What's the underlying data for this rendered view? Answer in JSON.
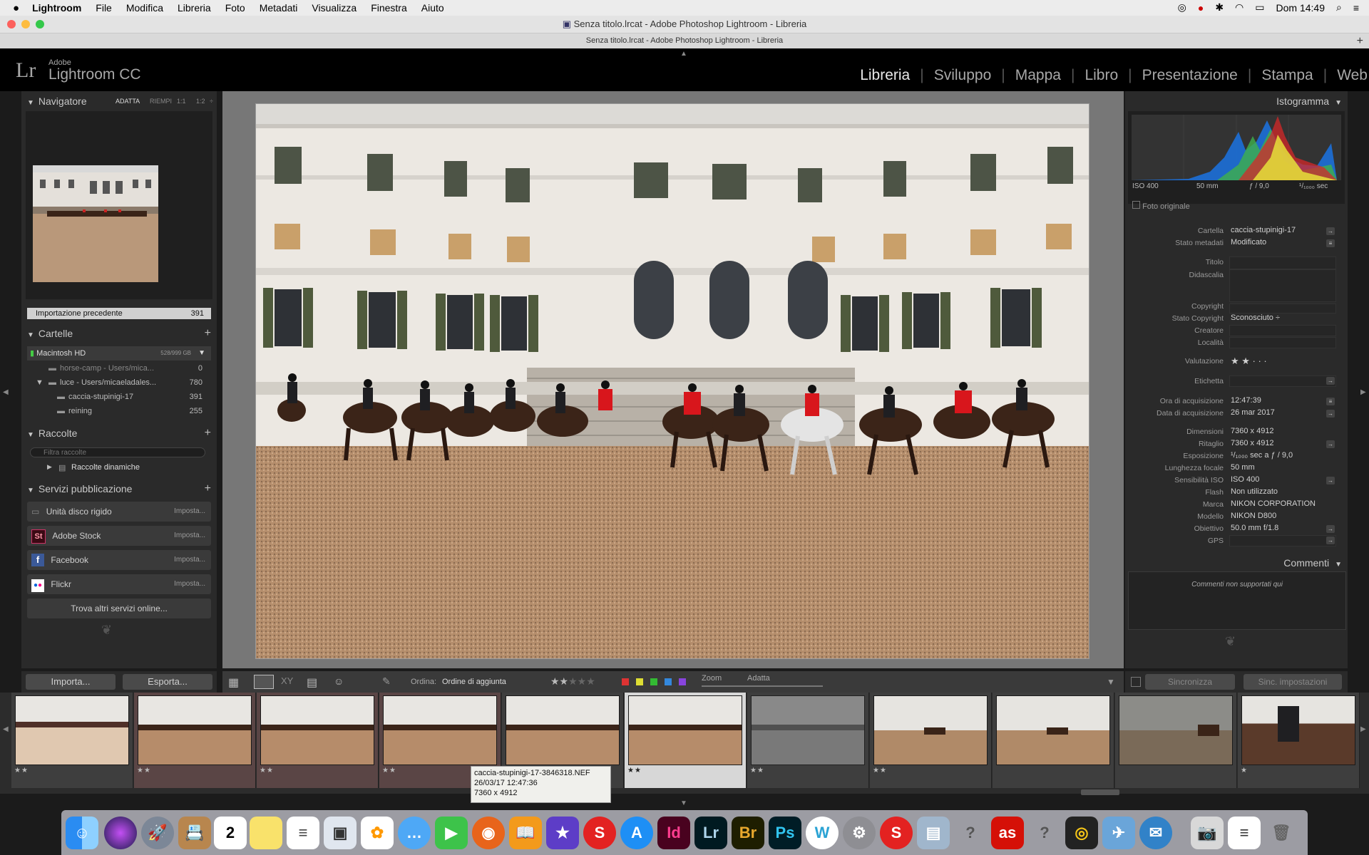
{
  "menubar": {
    "app_name": "Lightroom",
    "items": [
      "File",
      "Modifica",
      "Libreria",
      "Foto",
      "Metadati",
      "Visualizza",
      "Finestra",
      "Aiuto"
    ],
    "clock": "Dom 14:49"
  },
  "window": {
    "title": "Senza titolo.lrcat - Adobe Photoshop Lightroom - Libreria",
    "subtitle": "Senza titolo.lrcat - Adobe Photoshop Lightroom - Libreria"
  },
  "brand": {
    "logo": "Lr",
    "line1": "Adobe",
    "line2": "Lightroom CC"
  },
  "modules": [
    "Libreria",
    "Sviluppo",
    "Mappa",
    "Libro",
    "Presentazione",
    "Stampa",
    "Web"
  ],
  "navigator": {
    "title": "Navigatore",
    "zoom_options": [
      "ADATTA",
      "RIEMPI",
      "1:1",
      "1:2"
    ]
  },
  "catalog": {
    "label": "Importazione precedente",
    "count": "391"
  },
  "folders": {
    "title": "Cartelle",
    "volume": {
      "name": "Macintosh HD",
      "size": "528/999 GB"
    },
    "items": [
      {
        "name": "horse-camp - Users/mica...",
        "count": "0"
      },
      {
        "name": "luce - Users/micaeladales...",
        "count": "780"
      },
      {
        "name": "caccia-stupinigi-17",
        "count": "391"
      },
      {
        "name": "reining",
        "count": "255"
      }
    ]
  },
  "collections": {
    "title": "Raccolte",
    "filter_placeholder": "Filtra raccolte",
    "item": "Raccolte dinamiche"
  },
  "publish": {
    "title": "Servizi pubblicazione",
    "services": [
      {
        "name": "Unità disco rigido",
        "action": "Imposta..."
      },
      {
        "name": "Adobe Stock",
        "action": "Imposta..."
      },
      {
        "name": "Facebook",
        "action": "Imposta..."
      },
      {
        "name": "Flickr",
        "action": "Imposta..."
      }
    ],
    "find_more": "Trova altri servizi online..."
  },
  "histogram": {
    "title": "Istogramma",
    "iso": "ISO 400",
    "focal": "50 mm",
    "aperture": "ƒ / 9,0",
    "shutter": "¹/₁₀₀₀ sec",
    "original_label": "Foto originale"
  },
  "metadata": {
    "rows": [
      {
        "label": "Cartella",
        "value": "caccia-stupinigi-17"
      },
      {
        "label": "Stato metadati",
        "value": "Modificato"
      },
      {
        "label": "Titolo",
        "value": ""
      },
      {
        "label": "Didascalia",
        "value": ""
      },
      {
        "label": "Copyright",
        "value": ""
      },
      {
        "label": "Stato Copyright",
        "value": "Sconosciuto ÷"
      },
      {
        "label": "Creatore",
        "value": ""
      },
      {
        "label": "Località",
        "value": ""
      },
      {
        "label": "Valutazione",
        "value": "★ ★ · · ·"
      },
      {
        "label": "Etichetta",
        "value": ""
      },
      {
        "label": "Ora di acquisizione",
        "value": "12:47:39"
      },
      {
        "label": "Data di acquisizione",
        "value": "26 mar 2017"
      },
      {
        "label": "Dimensioni",
        "value": "7360 x 4912"
      },
      {
        "label": "Ritaglio",
        "value": "7360 x 4912"
      },
      {
        "label": "Esposizione",
        "value": "¹/₁₀₀₀ sec a ƒ / 9,0"
      },
      {
        "label": "Lunghezza focale",
        "value": "50 mm"
      },
      {
        "label": "Sensibilità ISO",
        "value": "ISO 400"
      },
      {
        "label": "Flash",
        "value": "Non utilizzato"
      },
      {
        "label": "Marca",
        "value": "NIKON CORPORATION"
      },
      {
        "label": "Modello",
        "value": "NIKON D800"
      },
      {
        "label": "Obiettivo",
        "value": "50.0 mm f/1.8"
      },
      {
        "label": "GPS",
        "value": ""
      }
    ]
  },
  "comments": {
    "title": "Commenti",
    "placeholder": "Commenti non supportati qui"
  },
  "bottom": {
    "import": "Importa...",
    "export": "Esporta...",
    "sort_label": "Ordina:",
    "sort_value": "Ordine di aggiunta",
    "zoom_label": "Zoom",
    "fit_label": "Adatta",
    "sync": "Sincronizza",
    "sync_settings": "Sinc. impostazioni"
  },
  "tooltip": {
    "filename": "caccia-stupinigi-17-3846318.NEF",
    "datetime": "26/03/17 12:47:36",
    "dimensions": "7360 x 4912"
  },
  "filmstrip_ratings": [
    "★★",
    "★★",
    "★★",
    "★★",
    "",
    "★★",
    "★★",
    "★★",
    "",
    "",
    "★"
  ],
  "dock_icons": [
    "finder-icon",
    "siri-icon",
    "launchpad-icon",
    "contacts-icon",
    "calendar-icon",
    "notes-icon",
    "reminders-icon",
    "preview-icon",
    "photos-icon",
    "messages-icon",
    "facetime-icon",
    "firefox-icon",
    "ibooks-icon",
    "imovie-icon",
    "acrobat-icon",
    "appstore-icon",
    "indesign-icon",
    "lightroom-icon",
    "bridge-icon",
    "photoshop-icon",
    "word-icon",
    "preferences-icon",
    "acrobat2-icon",
    "photo-viewer-icon",
    "help-icon",
    "lastfm-icon",
    "help2-icon",
    "scanner-icon",
    "finder-app-icon",
    "airmail-icon",
    "camera-icon",
    "textedit-icon",
    "trash-icon"
  ],
  "colors": {
    "accent": "#e8e8e8",
    "panel": "#2a2a2a",
    "center": "#777777"
  }
}
